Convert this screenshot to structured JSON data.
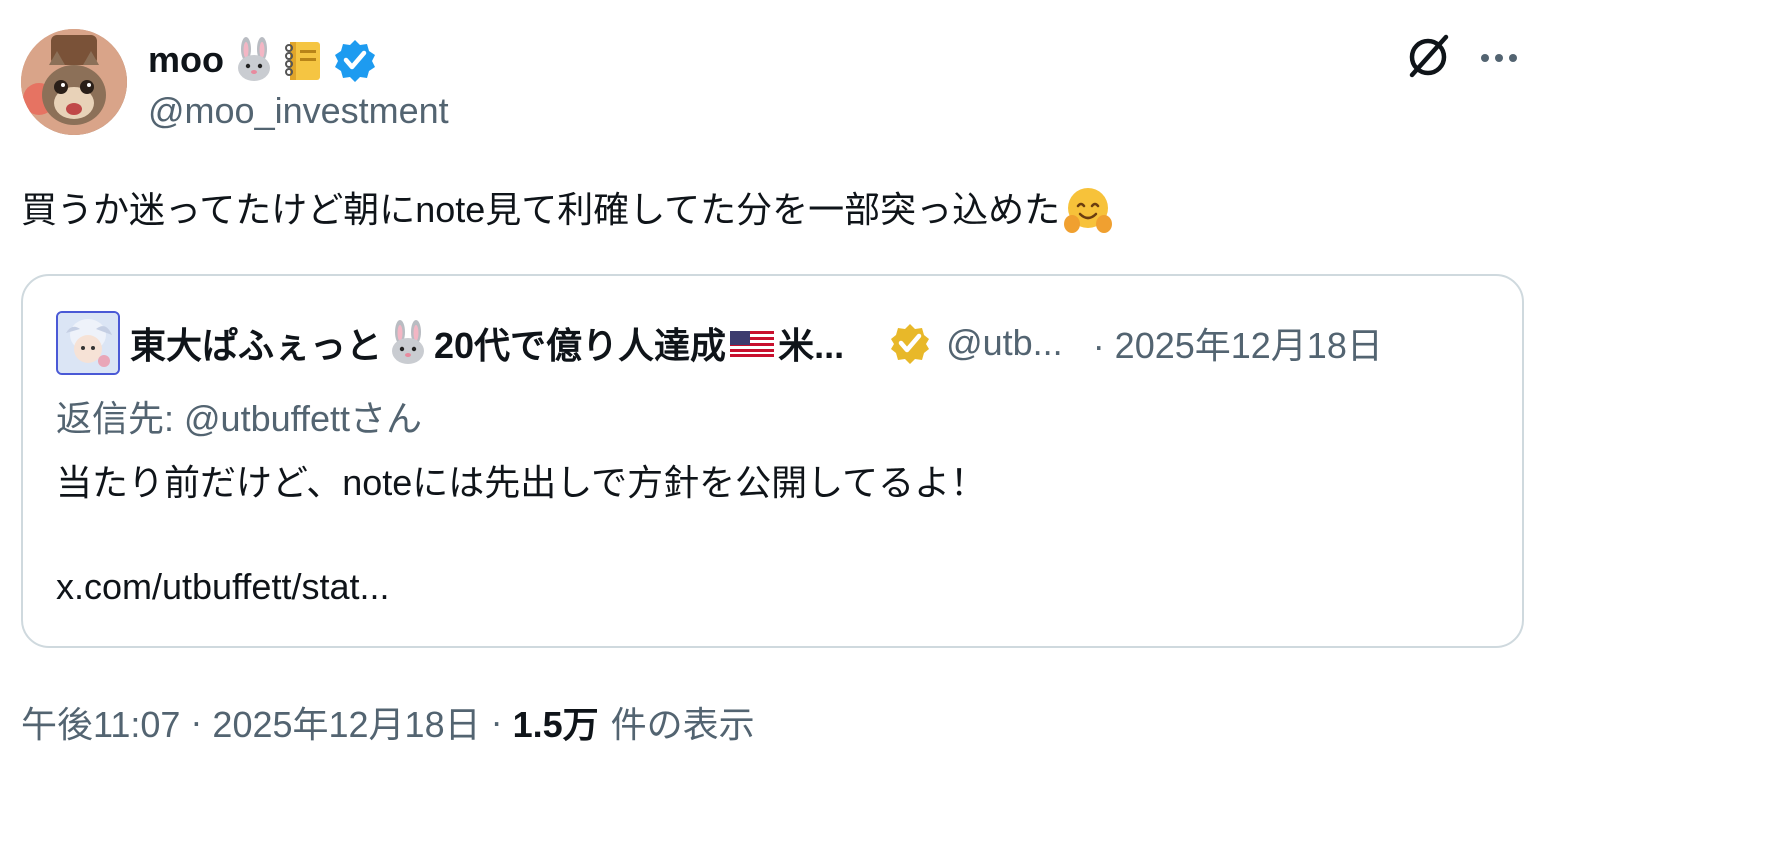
{
  "author": {
    "display_name": "moo",
    "handle": "@moo_investment",
    "name_emojis": [
      "rabbit-face",
      "ledger-notebook"
    ],
    "verified": true,
    "verified_color": "#1d9bf0"
  },
  "tweet": {
    "text": "買うか迷ってたけど朝にnote見て利確してた分を一部突っ込めた",
    "trailing_emoji": "hugging-face"
  },
  "quote": {
    "name_part1": "東大ぱふぇっと",
    "name_part2": "20代で億り人達成",
    "name_part3": "米...",
    "name_emojis": [
      "rabbit-face",
      "us-flag"
    ],
    "badge": "gold-verified",
    "badge_color": "#e8b829",
    "handle": "@utb...",
    "date": "· 2025年12月18日",
    "reply_to": "返信先: @utbuffettさん",
    "body": "当たり前だけど、noteには先出しで方針を公開してるよ！",
    "link": "x.com/utbuffett/stat..."
  },
  "meta": {
    "time": "午後11:07",
    "date": "2025年12月18日",
    "separator": "·",
    "views_count": "1.5万",
    "views_label": "件の表示"
  },
  "icons": {
    "grok": "grok-icon",
    "more": "more-options-icon"
  },
  "colors": {
    "text_primary": "#0f1419",
    "text_secondary": "#536471",
    "border": "#cfd9de"
  }
}
